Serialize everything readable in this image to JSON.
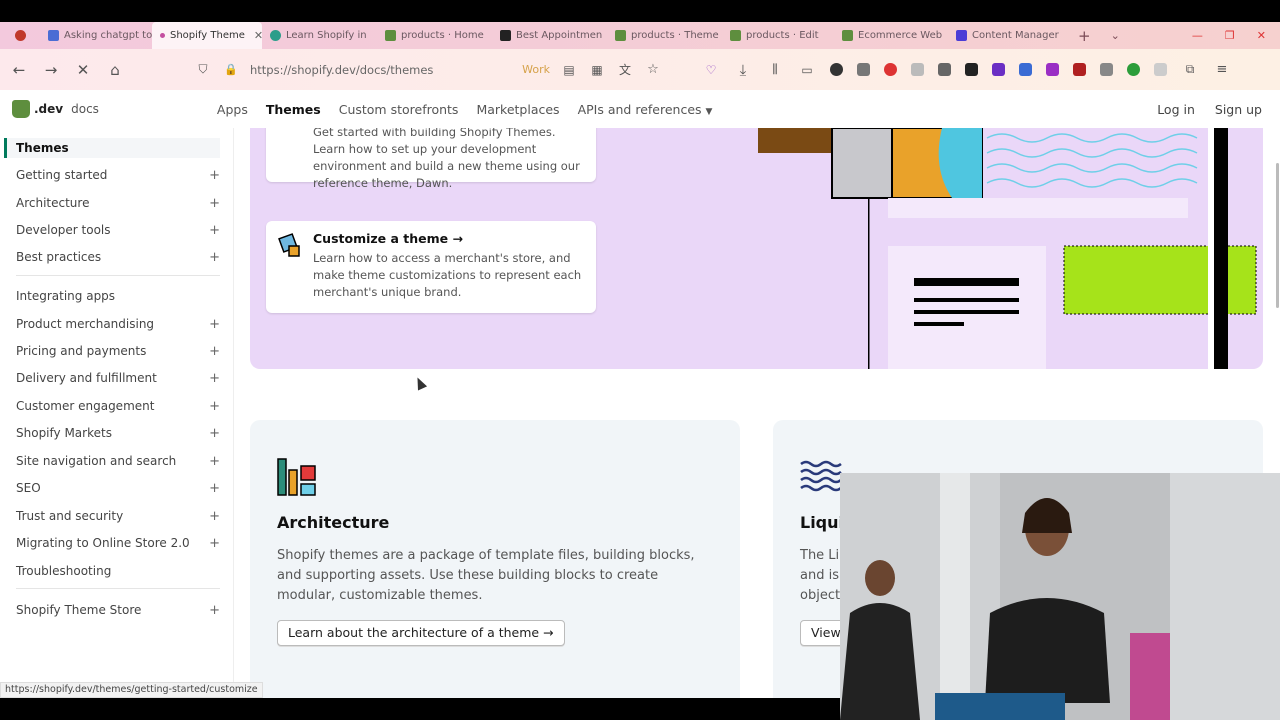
{
  "browser": {
    "tabs": [
      {
        "label": "Asking chatgpt to",
        "color": "#4a6cd4"
      },
      {
        "label": "Shopify Theme",
        "color": "#c44fa0",
        "active": true
      },
      {
        "label": "Learn Shopify in",
        "color": "#2c9d8a"
      },
      {
        "label": "products · Home",
        "color": "#5e8e3e"
      },
      {
        "label": "Best Appointmen",
        "color": "#222222"
      },
      {
        "label": "products · Theme",
        "color": "#5e8e3e"
      },
      {
        "label": "products · Edit",
        "color": "#5e8e3e"
      },
      {
        "label": "Ecommerce Web",
        "color": "#5e8e3e"
      },
      {
        "label": "Content Manager",
        "color": "#4b3cd6"
      }
    ],
    "new_tab": "+",
    "url": "https://shopify.dev/docs/themes",
    "container_label": "Work"
  },
  "site": {
    "logo_text": ".dev",
    "logo_sub": "docs",
    "nav": [
      {
        "label": "Apps"
      },
      {
        "label": "Themes",
        "active": true
      },
      {
        "label": "Custom storefronts"
      },
      {
        "label": "Marketplaces"
      },
      {
        "label": "APIs and references"
      }
    ],
    "login": "Log in",
    "signup": "Sign up"
  },
  "sidebar": {
    "active": "Themes",
    "items": [
      {
        "label": "Getting started",
        "expand": "+"
      },
      {
        "label": "Architecture",
        "expand": "+"
      },
      {
        "label": "Developer tools",
        "expand": "+"
      },
      {
        "label": "Best practices",
        "expand": "+"
      },
      {
        "label": "Integrating apps",
        "expand": ""
      },
      {
        "label": "Product merchandising",
        "expand": "+"
      },
      {
        "label": "Pricing and payments",
        "expand": "+"
      },
      {
        "label": "Delivery and fulfillment",
        "expand": "+"
      },
      {
        "label": "Customer engagement",
        "expand": "+"
      },
      {
        "label": "Shopify Markets",
        "expand": "+"
      },
      {
        "label": "Site navigation and search",
        "expand": "+"
      },
      {
        "label": "SEO",
        "expand": "+"
      },
      {
        "label": "Trust and security",
        "expand": "+"
      },
      {
        "label": "Migrating to Online Store 2.0",
        "expand": "+"
      },
      {
        "label": "Troubleshooting",
        "expand": ""
      },
      {
        "label": "Shopify Theme Store",
        "expand": "+"
      }
    ]
  },
  "hero": {
    "card1": {
      "desc": "Get started with building Shopify Themes. Learn how to set up your development environment and build a new theme using our reference theme, Dawn."
    },
    "card2": {
      "title": "Customize a theme →",
      "desc": "Learn how to access a merchant's store, and make theme customizations to represent each merchant's unique brand."
    }
  },
  "sections": {
    "architecture": {
      "title": "Architecture",
      "desc": "Shopify themes are a package of template files, building blocks, and supporting assets. Use these building blocks to create modular, customizable themes.",
      "button": "Learn about the architecture of a theme →"
    },
    "liquid": {
      "title": "Liqui",
      "desc_lines": [
        "The Li",
        "and is",
        "object"
      ],
      "button": "View"
    }
  },
  "status_url": "https://shopify.dev/themes/getting-started/customize"
}
